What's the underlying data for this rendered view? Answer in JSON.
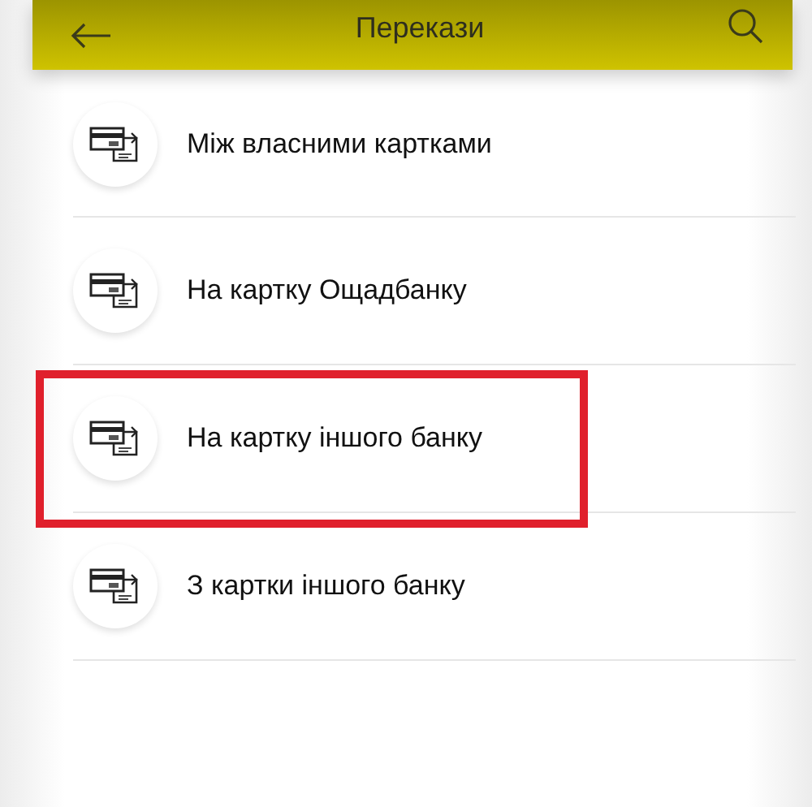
{
  "header": {
    "title": "Перекази"
  },
  "items": [
    {
      "label": "Між власними картками",
      "highlighted": false
    },
    {
      "label": "На картку Ощадбанку",
      "highlighted": false
    },
    {
      "label": "На картку іншого банку",
      "highlighted": true
    },
    {
      "label": "З картки іншого банку",
      "highlighted": false
    }
  ]
}
